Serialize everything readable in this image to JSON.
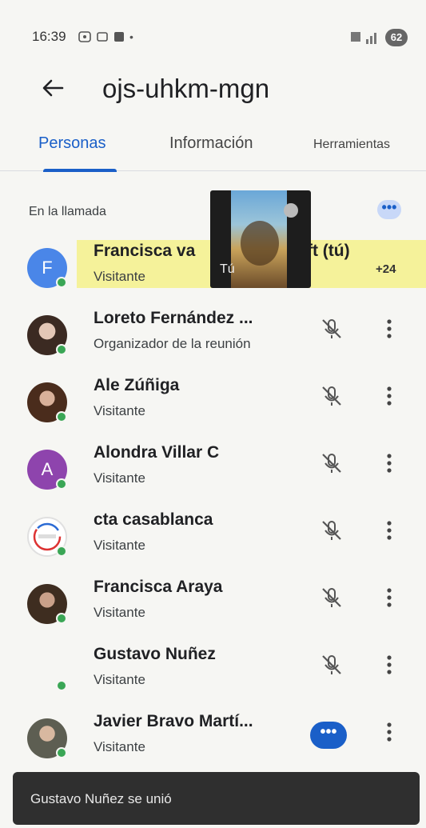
{
  "status_bar": {
    "time": "16:39",
    "battery": "62"
  },
  "header": {
    "title": "ojs-uhkm-mgn"
  },
  "tabs": [
    {
      "label": "Personas",
      "active": true
    },
    {
      "label": "Información",
      "active": false
    },
    {
      "label": "Herramientas",
      "active": false
    }
  ],
  "section": {
    "label": "En la llamada"
  },
  "participants": [
    {
      "name": "Francisca va",
      "name_tail": "aft (tú)",
      "role": "Visitante",
      "avatar_letter": "F",
      "avatar_color": "#4a86e8",
      "mic": "none"
    },
    {
      "name": "Loreto Fernández ...",
      "role": "Organizador de la reunión",
      "avatar_letter": "",
      "avatar_color": "#6b5346",
      "mic": "muted"
    },
    {
      "name": "Ale Zúñiga",
      "role": "Visitante",
      "avatar_letter": "",
      "avatar_color": "#5a3a2a",
      "mic": "muted"
    },
    {
      "name": "Alondra Villar C",
      "role": "Visitante",
      "avatar_letter": "A",
      "avatar_color": "#8e44ad",
      "mic": "muted"
    },
    {
      "name": "cta casablanca",
      "role": "Visitante",
      "avatar_letter": "",
      "avatar_color": "#ffffff",
      "mic": "muted"
    },
    {
      "name": "Francisca Araya",
      "role": "Visitante",
      "avatar_letter": "",
      "avatar_color": "#4b3a2c",
      "mic": "muted"
    },
    {
      "name": "Gustavo Nuñez",
      "role": "Visitante",
      "avatar_letter": "",
      "avatar_color": "transparent",
      "mic": "muted"
    },
    {
      "name": "Javier Bravo Martí...",
      "role": "Visitante",
      "avatar_letter": "",
      "avatar_color": "#7a7a70",
      "mic": "speaking"
    }
  ],
  "pip": {
    "label": "Tú"
  },
  "plus_count": "+24",
  "toast": {
    "text": "Gustavo Nuñez se unió"
  },
  "colors": {
    "accent": "#1a5fc8",
    "online": "#3aa655"
  }
}
